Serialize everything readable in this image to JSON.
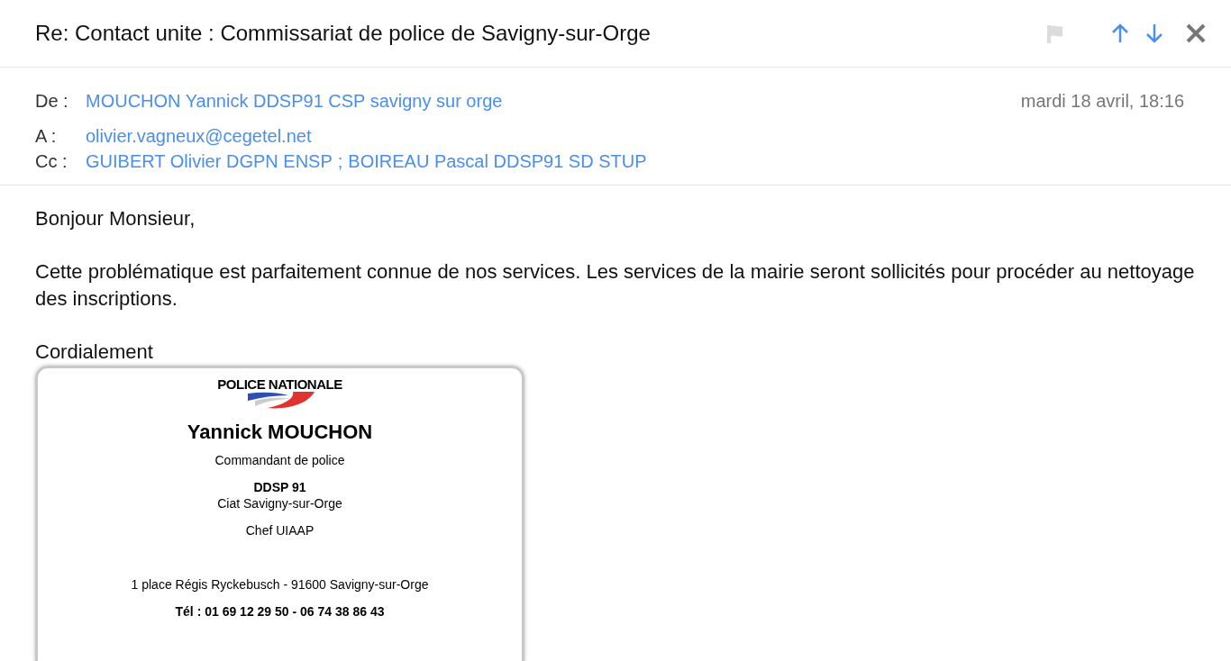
{
  "header": {
    "subject": "Re: Contact unite : Commissariat de police de Savigny-sur-Orge",
    "flagged": false
  },
  "fields": [
    {
      "label": "De :",
      "recipients": [
        "MOUCHON Yannick DDSP91 CSP savigny sur orge"
      ],
      "date": "mardi 18 avril, 18:16"
    },
    {
      "label": "A :",
      "recipients": [
        "olivier.vagneux@cegetel.net"
      ]
    },
    {
      "label": "Cc :",
      "recipients": [
        "GUIBERT Olivier DGPN ENSP",
        "BOIREAU Pascal DDSP91 SD STUP"
      ],
      "separator": ";"
    }
  ],
  "body": [
    "Bonjour Monsieur,",
    "Cette problématique est parfaitement connue  de nos services. Les services de la mairie seront sollicités pour procéder au nettoyage des inscriptions.",
    "Cordialement"
  ],
  "signature": {
    "logo_text": "POLICE NATIONALE",
    "name": "Yannick MOUCHON",
    "title": "Commandant de police",
    "unit": "DDSP 91",
    "office": "Ciat Savigny-sur-Orge",
    "role": "Chef UIAAP",
    "address": "1 place Régis Ryckebusch - 91600 Savigny-sur-Orge",
    "phone": "Tél : 01 69 12 29 50 - 06 74 38 86 43"
  }
}
